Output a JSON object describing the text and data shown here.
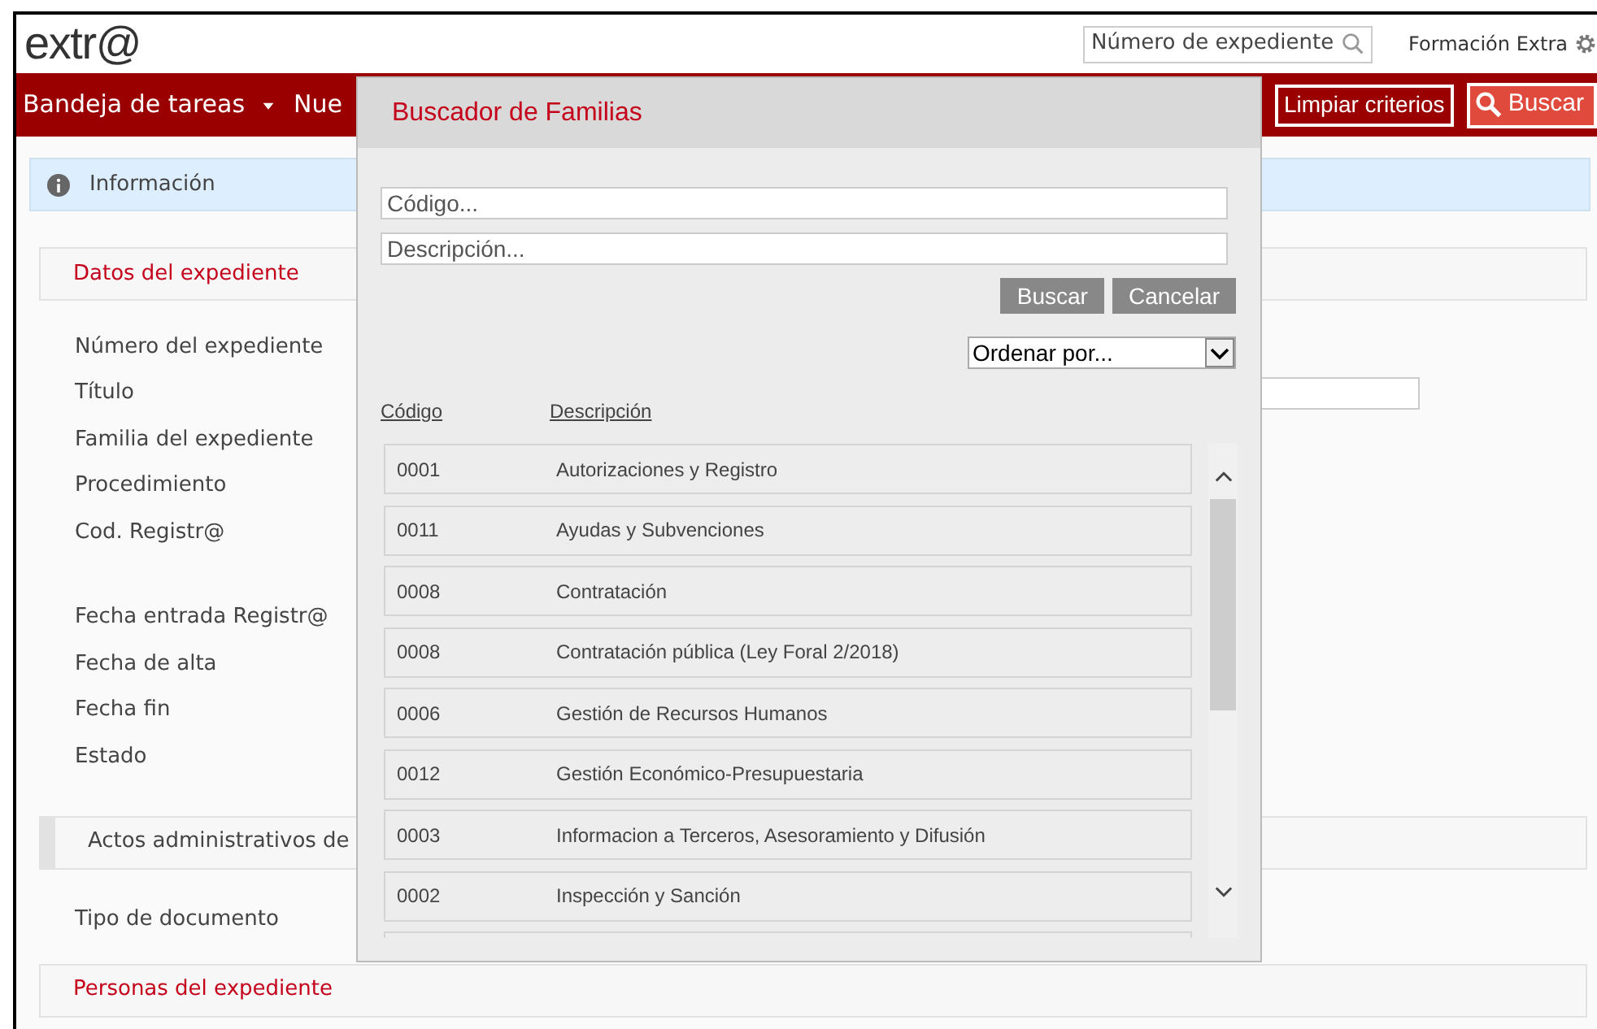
{
  "header": {
    "logo": "extr@",
    "search": {
      "placeholder": "Número de expediente"
    },
    "user": "Formación Extra"
  },
  "nav": {
    "items": [
      {
        "label": "Bandeja de tareas",
        "dropdown": true
      },
      {
        "label": "Nue",
        "dropdown": false
      }
    ],
    "buttons": [
      {
        "label": "Limpiar criterios",
        "kind": "outline"
      },
      {
        "label": "Buscar",
        "kind": "primary"
      }
    ]
  },
  "info": "Información",
  "datos": {
    "title": "Datos del expediente",
    "field_groups": [
      [
        {
          "label": "Número del expediente",
          "kind": "plain"
        },
        {
          "label": "Título",
          "kind": "text-input"
        },
        {
          "label": "Familia del expediente",
          "kind": "plain"
        },
        {
          "label": "Procedimiento",
          "kind": "plain"
        },
        {
          "label": "Cod. Registr@",
          "kind": "plain"
        }
      ],
      [
        {
          "label": "Fecha entrada Registr@",
          "kind": "plain"
        },
        {
          "label": "Fecha de alta",
          "kind": "plain"
        },
        {
          "label": "Fecha fin",
          "kind": "plain"
        },
        {
          "label": "Estado",
          "kind": "plain"
        }
      ]
    ]
  },
  "actos": {
    "title": "Actos administrativos de",
    "fields": [
      "Tipo de documento"
    ]
  },
  "personas": {
    "title": "Personas del expediente"
  },
  "modal": {
    "title": "Buscador de Familias",
    "code_field": {
      "placeholder": "Código..."
    },
    "description_field": {
      "placeholder": "Descripción..."
    },
    "buttons": [
      "Buscar",
      "Cancelar"
    ],
    "sort": {
      "value": "Ordenar por..."
    },
    "columns": [
      "Código",
      "Descripción"
    ],
    "rows": [
      {
        "code": "0001",
        "description": "Autorizaciones y Registro"
      },
      {
        "code": "0011",
        "description": "Ayudas y Subvenciones"
      },
      {
        "code": "0008",
        "description": "Contratación"
      },
      {
        "code": "0008",
        "description": "Contratación pública (Ley Foral 2/2018)"
      },
      {
        "code": "0006",
        "description": "Gestión de Recursos Humanos"
      },
      {
        "code": "0012",
        "description": "Gestión Económico-Presupuestaria"
      },
      {
        "code": "0003",
        "description": "Informacion a Terceros, Asesoramiento y Difusión"
      },
      {
        "code": "0002",
        "description": "Inspección y Sanción"
      }
    ]
  }
}
